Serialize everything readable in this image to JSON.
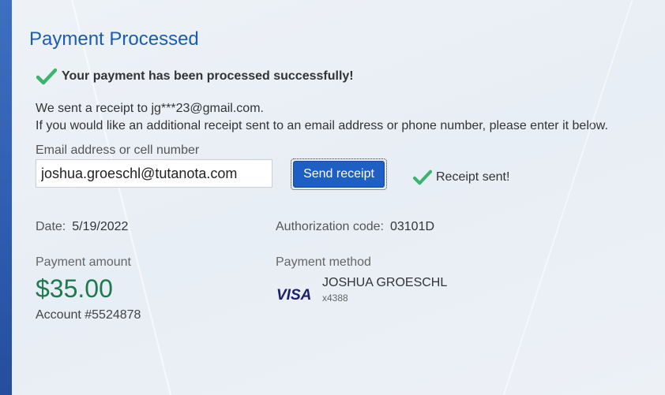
{
  "page": {
    "title": "Payment Processed",
    "success_message": "Your payment has been processed successfully!",
    "receipt_sent_line": "We sent a receipt to jg***23@gmail.com.",
    "additional_receipt_line": "If you would like an additional receipt sent to an email address or phone number, please enter it below."
  },
  "receipt_form": {
    "label": "Email address or cell number",
    "value": "joshua.groeschl@tutanota.com",
    "button_label": "Send receipt",
    "status_text": "Receipt sent!"
  },
  "details": {
    "date_label": "Date:",
    "date_value": "5/19/2022",
    "auth_label": "Authorization code:",
    "auth_value": "03101D",
    "amount_label": "Payment amount",
    "amount_value": "$35.00",
    "account_prefix": "Account #",
    "account_number": "5524878",
    "method_label": "Payment method",
    "card_brand": "VISA",
    "card_name": "JOSHUA GROESCHL",
    "card_last4": "x4388"
  },
  "icons": {
    "success": "check-icon",
    "card": "visa-logo"
  },
  "colors": {
    "title": "#1a5cb0",
    "check": "#3cb46e",
    "amount": "#1e7a4c",
    "button": "#1e5fc4",
    "visa": "#1a1f71"
  }
}
